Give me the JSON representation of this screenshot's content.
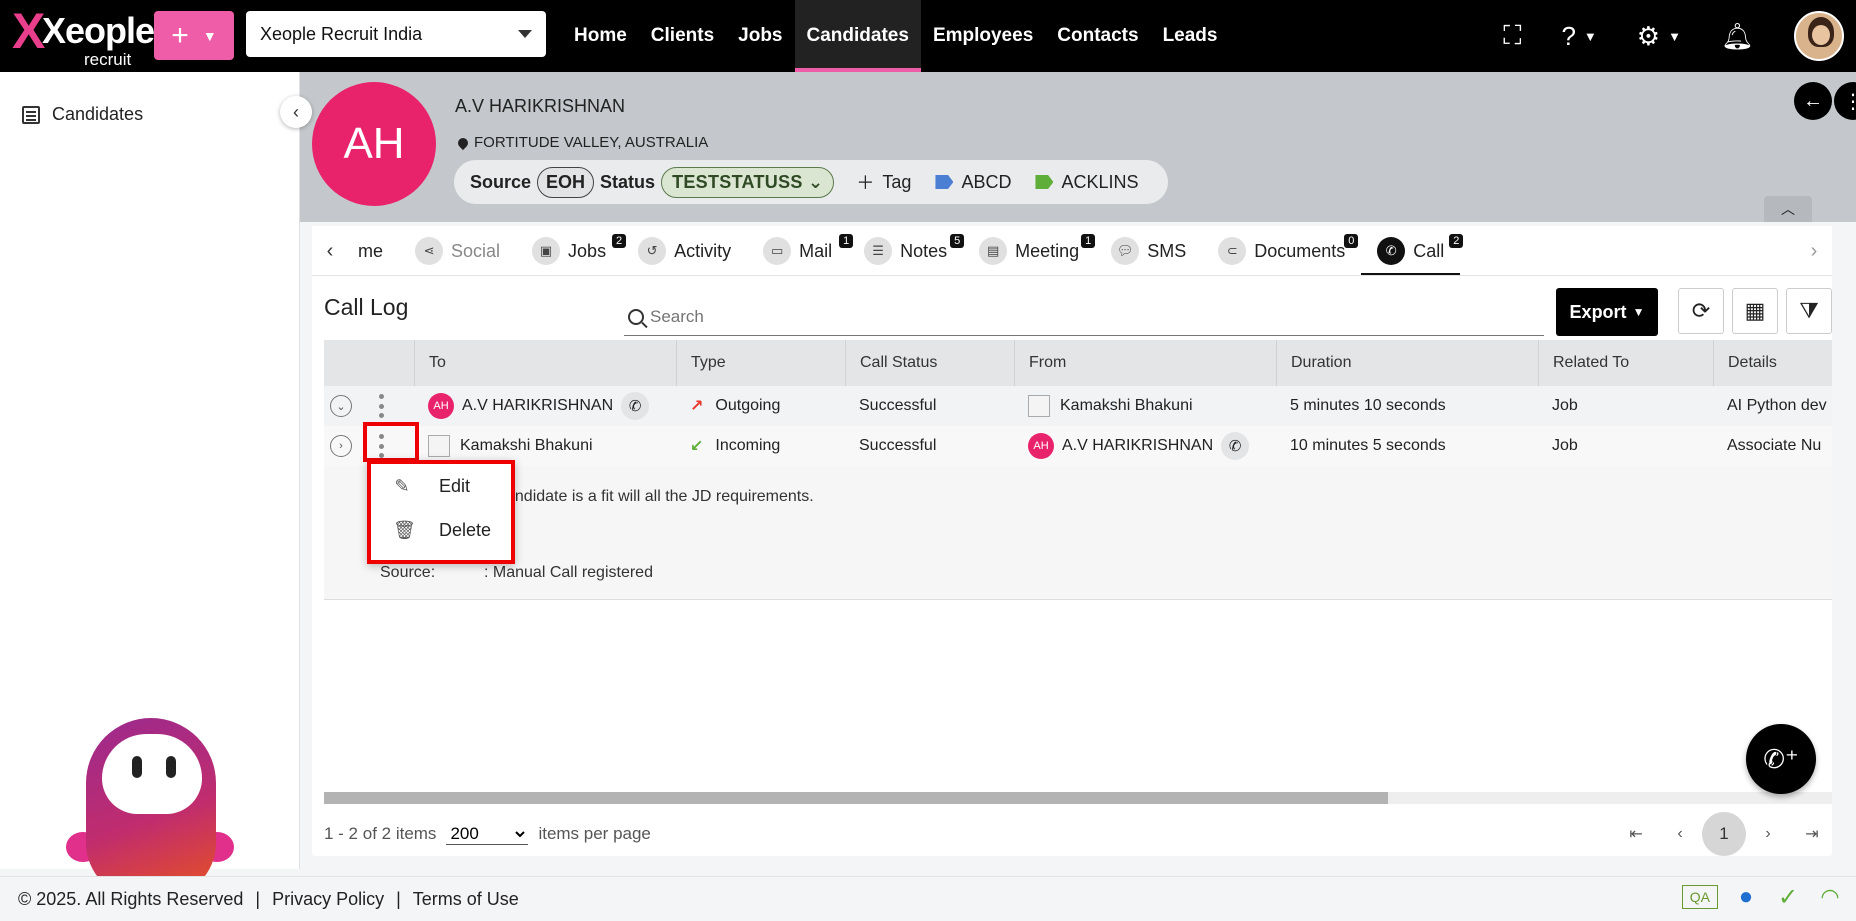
{
  "brand": {
    "logo_text": "Xeople",
    "logo_sub": "recruit"
  },
  "topbar": {
    "add_label": "+",
    "org_selector": "Xeople Recruit India",
    "nav": [
      "Home",
      "Clients",
      "Jobs",
      "Candidates",
      "Employees",
      "Contacts",
      "Leads"
    ],
    "active_nav": "Candidates"
  },
  "sidebar": {
    "items": [
      {
        "label": "Candidates"
      }
    ]
  },
  "candidate": {
    "initials": "AH",
    "name": "A.V HARIKRISHNAN",
    "location": "FORTITUDE VALLEY, AUSTRALIA",
    "source_label": "Source",
    "source_value": "EOH",
    "status_label": "Status",
    "status_value": "TESTSTATUSS",
    "add_tag_label": "Tag",
    "tags": [
      {
        "label": "ABCD",
        "color": "#4a7fd4"
      },
      {
        "label": "ACKLINS",
        "color": "#5fae3a"
      }
    ]
  },
  "tabs": [
    {
      "label": "me",
      "badge": ""
    },
    {
      "label": "Social",
      "badge": "",
      "disabled": true
    },
    {
      "label": "Jobs",
      "badge": "2"
    },
    {
      "label": "Activity",
      "badge": ""
    },
    {
      "label": "Mail",
      "badge": "1"
    },
    {
      "label": "Notes",
      "badge": "5"
    },
    {
      "label": "Meeting",
      "badge": "1"
    },
    {
      "label": "SMS",
      "badge": ""
    },
    {
      "label": "Documents",
      "badge": "0"
    },
    {
      "label": "Call",
      "badge": "2",
      "active": true
    }
  ],
  "calllog": {
    "title": "Call Log",
    "search_placeholder": "Search",
    "export_label": "Export",
    "columns": [
      "To",
      "Type",
      "Call Status",
      "From",
      "Duration",
      "Related To",
      "Details"
    ],
    "rows": [
      {
        "to": "A.V HARIKRISHNAN",
        "to_initials": "AH",
        "type": "Outgoing",
        "status": "Successful",
        "from": "Kamakshi Bhakuni",
        "duration": "5 minutes 10 seconds",
        "related": "Job",
        "details": "AI Python dev"
      },
      {
        "to": "Kamakshi Bhakuni",
        "type": "Incoming",
        "status": "Successful",
        "from": "A.V HARIKRISHNAN",
        "from_initials": "AH",
        "duration": "10 minutes 5 seconds",
        "related": "Job",
        "details": "Associate Nu"
      }
    ],
    "detail_note": "andidate is a fit will all the JD requirements.",
    "detail_source_label": "Source:",
    "detail_source_value": ": Manual Call registered"
  },
  "context_menu": {
    "edit": "Edit",
    "delete": "Delete"
  },
  "pager": {
    "range": "1 - 2 of 2 items",
    "per_page": "200",
    "per_page_label": "items per page",
    "current": "1"
  },
  "footer": {
    "copyright": "© 2025. All Rights Reserved",
    "privacy": "Privacy Policy",
    "terms": "Terms of Use",
    "env": "QA"
  },
  "colors": {
    "accent": "#ef5da8",
    "avatar": "#e9236b",
    "outgoing": "#e8362b",
    "incoming": "#5fae3a"
  }
}
